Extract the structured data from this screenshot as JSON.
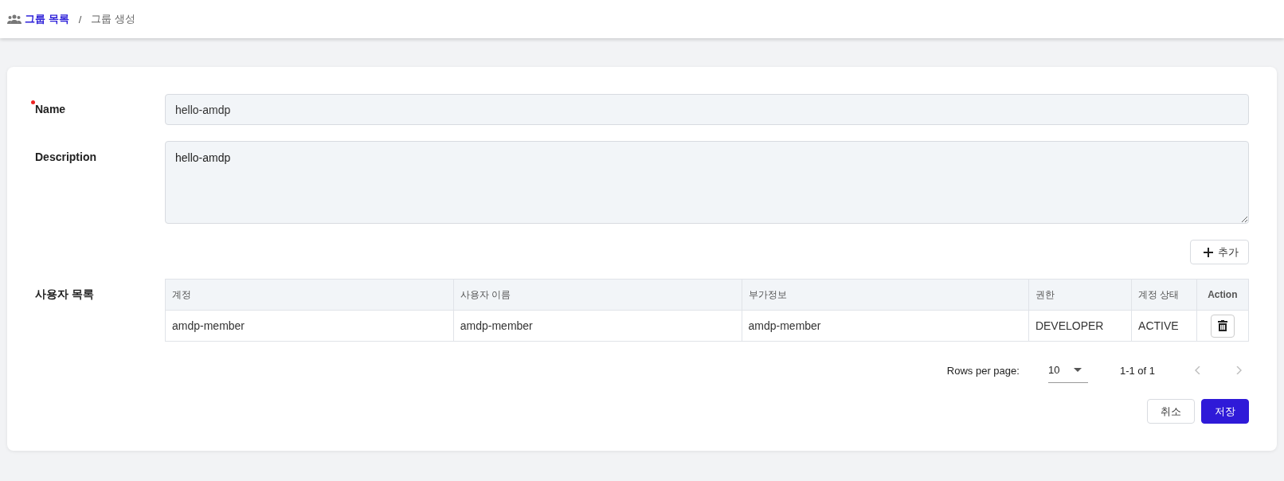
{
  "breadcrumb": [
    {
      "label": "그룹 목록",
      "selected": false
    },
    {
      "label": "그룹 생성",
      "selected": true
    }
  ],
  "breadcrumb_separator": "/",
  "form": {
    "fields": [
      {
        "kind": "input",
        "label": "Name",
        "required": true,
        "value": "hello-amdp"
      },
      {
        "kind": "textarea",
        "label": "Description",
        "required": false,
        "value": "hello-amdp"
      }
    ]
  },
  "add_button": "추가",
  "users": {
    "label": "사용자 목록",
    "columns": [
      "계정",
      "사용자 이름",
      "부가정보",
      "권한",
      "계정 상태",
      "Action"
    ],
    "rows": [
      {
        "cells": [
          "amdp-member",
          "amdp-member",
          "amdp-member",
          "DEVELOPER",
          "ACTIVE"
        ]
      }
    ]
  },
  "pagination": {
    "rows_per_page_label": "Rows per page:",
    "rows_per_page": "10",
    "range": "1-1 of 1",
    "prev_disabled": true,
    "next_disabled": true
  },
  "buttons": [
    {
      "kind": "secondary",
      "label": "취소"
    },
    {
      "kind": "primary",
      "label": "저장"
    }
  ]
}
